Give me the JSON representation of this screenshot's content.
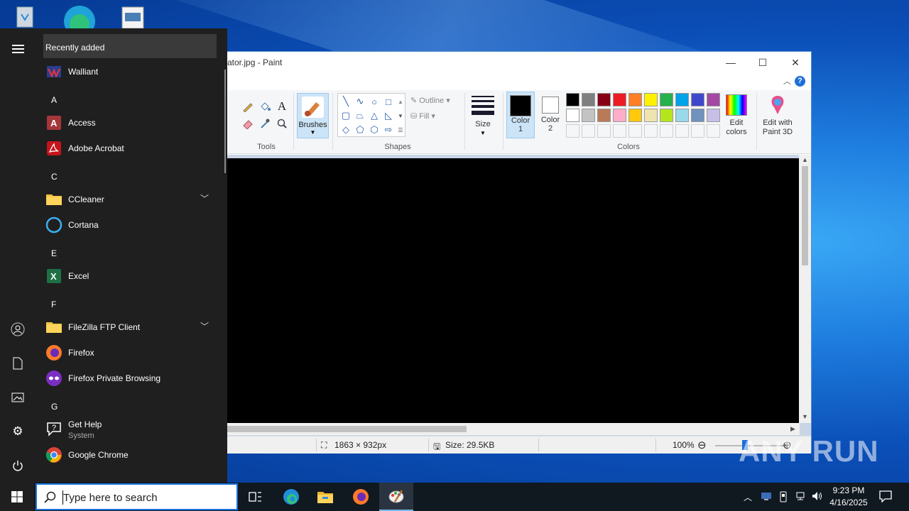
{
  "paint": {
    "title": "ator.jpg - Paint",
    "tools_label": "Tools",
    "brushes_label": "Brushes",
    "shapes_label": "Shapes",
    "outline_label": "Outline",
    "fill_label": "Fill",
    "size_label": "Size",
    "color1_label": "Color",
    "color1_num": "1",
    "color2_label": "Color",
    "color2_num": "2",
    "colors_label": "Colors",
    "edit_colors_l1": "Edit",
    "edit_colors_l2": "colors",
    "paint3d_l1": "Edit with",
    "paint3d_l2": "Paint 3D",
    "palette_row1": [
      "#000000",
      "#7f7f7f",
      "#880015",
      "#ed1c24",
      "#ff7f27",
      "#fff200",
      "#22b14c",
      "#00a2e8",
      "#3f48cc",
      "#a349a4"
    ],
    "palette_row2": [
      "#ffffff",
      "#c3c3c3",
      "#b97a57",
      "#ffaec9",
      "#ffc90e",
      "#efe4b0",
      "#b5e61d",
      "#99d9ea",
      "#7092be",
      "#c8bfe7"
    ],
    "status_dimensions": "1863 × 932px",
    "status_size": "Size: 29.5KB",
    "zoom": "100%"
  },
  "start_menu": {
    "recently_added": "Recently added",
    "items": [
      {
        "name": "Walliant"
      },
      {
        "name": "Access"
      },
      {
        "name": "Adobe Acrobat"
      },
      {
        "name": "CCleaner"
      },
      {
        "name": "Cortana"
      },
      {
        "name": "Excel"
      },
      {
        "name": "FileZilla FTP Client"
      },
      {
        "name": "Firefox"
      },
      {
        "name": "Firefox Private Browsing"
      },
      {
        "name": "Get Help",
        "sub": "System"
      },
      {
        "name": "Google Chrome"
      }
    ],
    "letters": [
      "A",
      "C",
      "E",
      "F",
      "G"
    ]
  },
  "taskbar": {
    "search_placeholder": "Type here to search",
    "time": "9:23 PM",
    "date": "4/16/2025"
  },
  "watermark": "ANY RUN"
}
